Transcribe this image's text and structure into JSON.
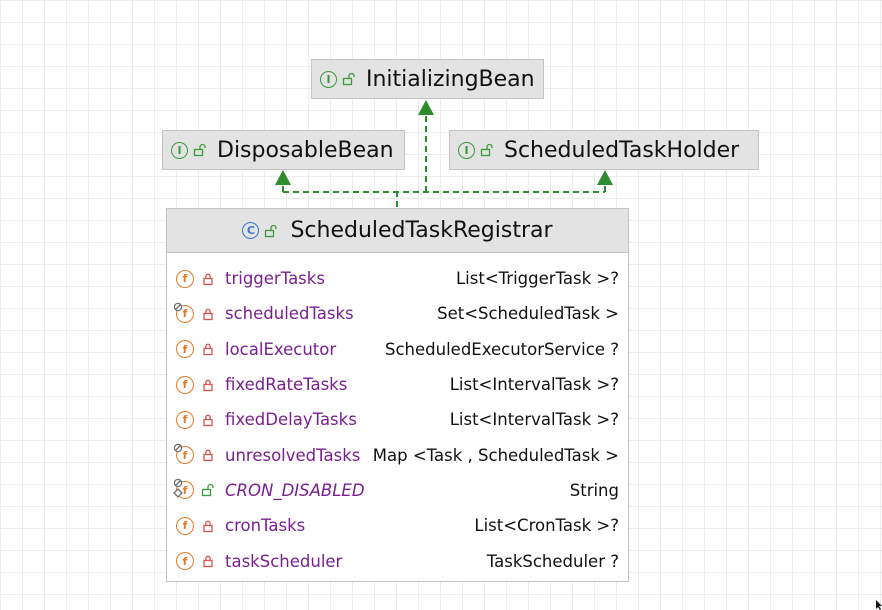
{
  "diagram": {
    "parents": {
      "initializing": {
        "name": "InitializingBean",
        "kind": "I",
        "kind_icon": "interface-icon",
        "visibility": "public"
      },
      "disposable": {
        "name": "DisposableBean",
        "kind": "I",
        "kind_icon": "interface-icon",
        "visibility": "public"
      },
      "holder": {
        "name": "ScheduledTaskHolder",
        "kind": "I",
        "kind_icon": "interface-icon",
        "visibility": "public"
      }
    },
    "main_class": {
      "name": "ScheduledTaskRegistrar",
      "kind": "C",
      "kind_icon": "class-icon",
      "visibility": "public",
      "fields": [
        {
          "name": "triggerTasks",
          "type": "List<TriggerTask >?",
          "visibility": "private",
          "final": false,
          "static": false
        },
        {
          "name": "scheduledTasks",
          "type": "Set<ScheduledTask >",
          "visibility": "private",
          "final": true,
          "static": false
        },
        {
          "name": "localExecutor",
          "type": "ScheduledExecutorService ?",
          "visibility": "private",
          "final": false,
          "static": false
        },
        {
          "name": "fixedRateTasks",
          "type": "List<IntervalTask >?",
          "visibility": "private",
          "final": false,
          "static": false
        },
        {
          "name": "fixedDelayTasks",
          "type": "List<IntervalTask >?",
          "visibility": "private",
          "final": false,
          "static": false
        },
        {
          "name": "unresolvedTasks",
          "type": "Map <Task , ScheduledTask >",
          "visibility": "private",
          "final": true,
          "static": false
        },
        {
          "name": "CRON_DISABLED",
          "type": "String",
          "visibility": "public",
          "final": true,
          "static": true
        },
        {
          "name": "cronTasks",
          "type": "List<CronTask >?",
          "visibility": "private",
          "final": false,
          "static": false
        },
        {
          "name": "taskScheduler",
          "type": "TaskScheduler ?",
          "visibility": "private",
          "final": false,
          "static": false
        }
      ]
    },
    "colors": {
      "connector": "#2e8b2e",
      "field_name": "#7a1f8f",
      "interface_icon": "#3b9a3b",
      "class_icon": "#3a73d1",
      "field_icon": "#e07b2a",
      "private_lock": "#d9534f",
      "public_lock": "#3b9a3b"
    }
  }
}
